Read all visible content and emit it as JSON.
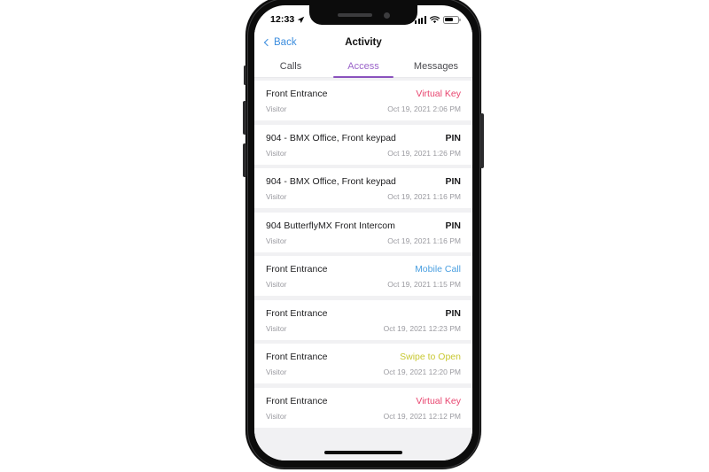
{
  "status_bar": {
    "time": "12:33",
    "location_arrow_icon": "location-arrow-icon",
    "signal_icon": "cellular-signal-icon",
    "wifi_icon": "wifi-icon",
    "battery_icon": "battery-icon",
    "battery_level_percent": 55
  },
  "nav": {
    "back_label": "Back",
    "title": "Activity"
  },
  "tabs": [
    {
      "label": "Calls",
      "selected": false
    },
    {
      "label": "Access",
      "selected": true
    },
    {
      "label": "Messages",
      "selected": false
    }
  ],
  "colors": {
    "accent_purple": "#8a52bd",
    "link_blue": "#3c8dde",
    "virtual_key_pink": "#e8456f",
    "mobile_call_blue": "#4a9fe0",
    "swipe_yellow": "#c8c832",
    "pin_black": "#1c1c1e",
    "list_background": "#f1f1f3"
  },
  "activity": [
    {
      "door": "Front Entrance",
      "method": "Virtual Key",
      "method_style": "virtual-key",
      "user": "Visitor",
      "timestamp": "Oct 19, 2021 2:06 PM"
    },
    {
      "door": "904 - BMX Office, Front keypad",
      "method": "PIN",
      "method_style": "pin",
      "user": "Visitor",
      "timestamp": "Oct 19, 2021 1:26 PM"
    },
    {
      "door": "904 - BMX Office, Front keypad",
      "method": "PIN",
      "method_style": "pin",
      "user": "Visitor",
      "timestamp": "Oct 19, 2021 1:16 PM"
    },
    {
      "door": "904 ButterflyMX Front Intercom",
      "method": "PIN",
      "method_style": "pin",
      "user": "Visitor",
      "timestamp": "Oct 19, 2021 1:16 PM"
    },
    {
      "door": "Front Entrance",
      "method": "Mobile Call",
      "method_style": "mobile-call",
      "user": "Visitor",
      "timestamp": "Oct 19, 2021 1:15 PM"
    },
    {
      "door": "Front Entrance",
      "method": "PIN",
      "method_style": "pin",
      "user": "Visitor",
      "timestamp": "Oct 19, 2021 12:23 PM"
    },
    {
      "door": "Front Entrance",
      "method": "Swipe to Open",
      "method_style": "swipe-to-open",
      "user": "Visitor",
      "timestamp": "Oct 19, 2021 12:20 PM"
    },
    {
      "door": "Front Entrance",
      "method": "Virtual Key",
      "method_style": "virtual-key",
      "user": "Visitor",
      "timestamp": "Oct 19, 2021 12:12 PM"
    }
  ]
}
